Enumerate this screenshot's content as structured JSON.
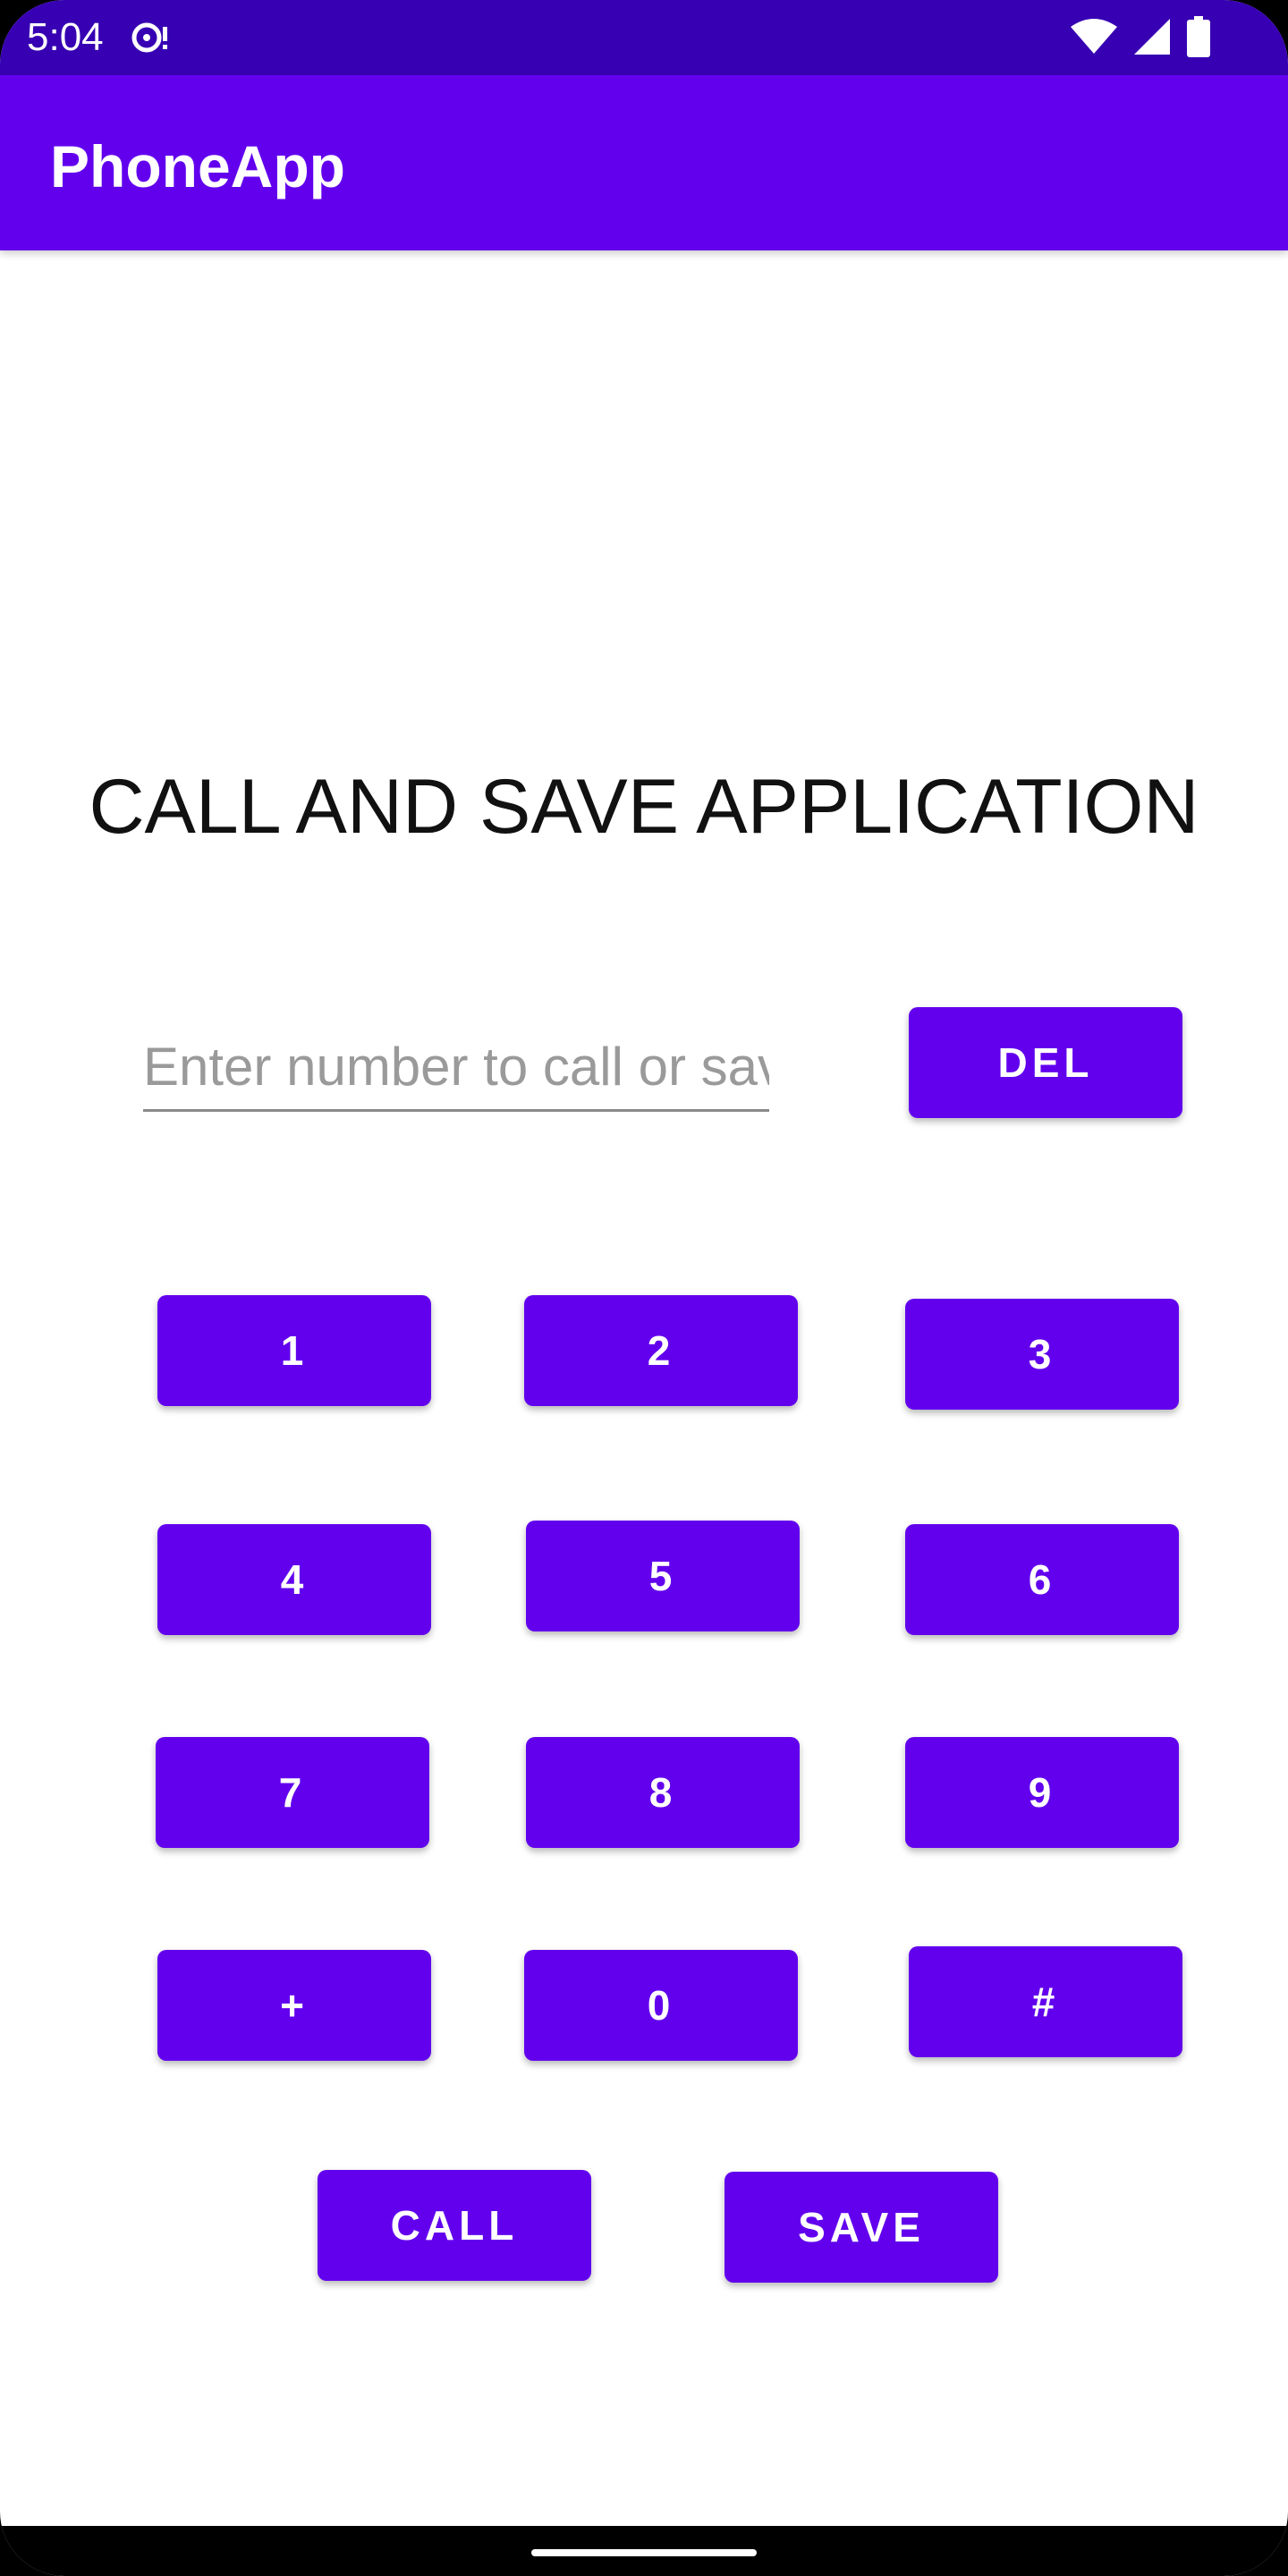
{
  "status_bar": {
    "time": "5:04",
    "icons": [
      "sync-icon",
      "wifi-icon",
      "signal-icon",
      "battery-icon"
    ]
  },
  "app_bar": {
    "title": "PhoneApp"
  },
  "main": {
    "heading": "CALL AND SAVE APPLICATION",
    "number_input": {
      "value": "",
      "placeholder": "Enter number to call or save"
    },
    "del_label": "DEL",
    "keypad": [
      "1",
      "2",
      "3",
      "4",
      "5",
      "6",
      "7",
      "8",
      "9",
      "+",
      "0",
      "#"
    ],
    "call_label": "CALL",
    "save_label": "SAVE"
  },
  "colors": {
    "primary": "#6200EE",
    "primary_dark": "#3700B3",
    "on_primary": "#FFFFFF",
    "background": "#FFFFFF",
    "hint": "#9A9A9A"
  }
}
